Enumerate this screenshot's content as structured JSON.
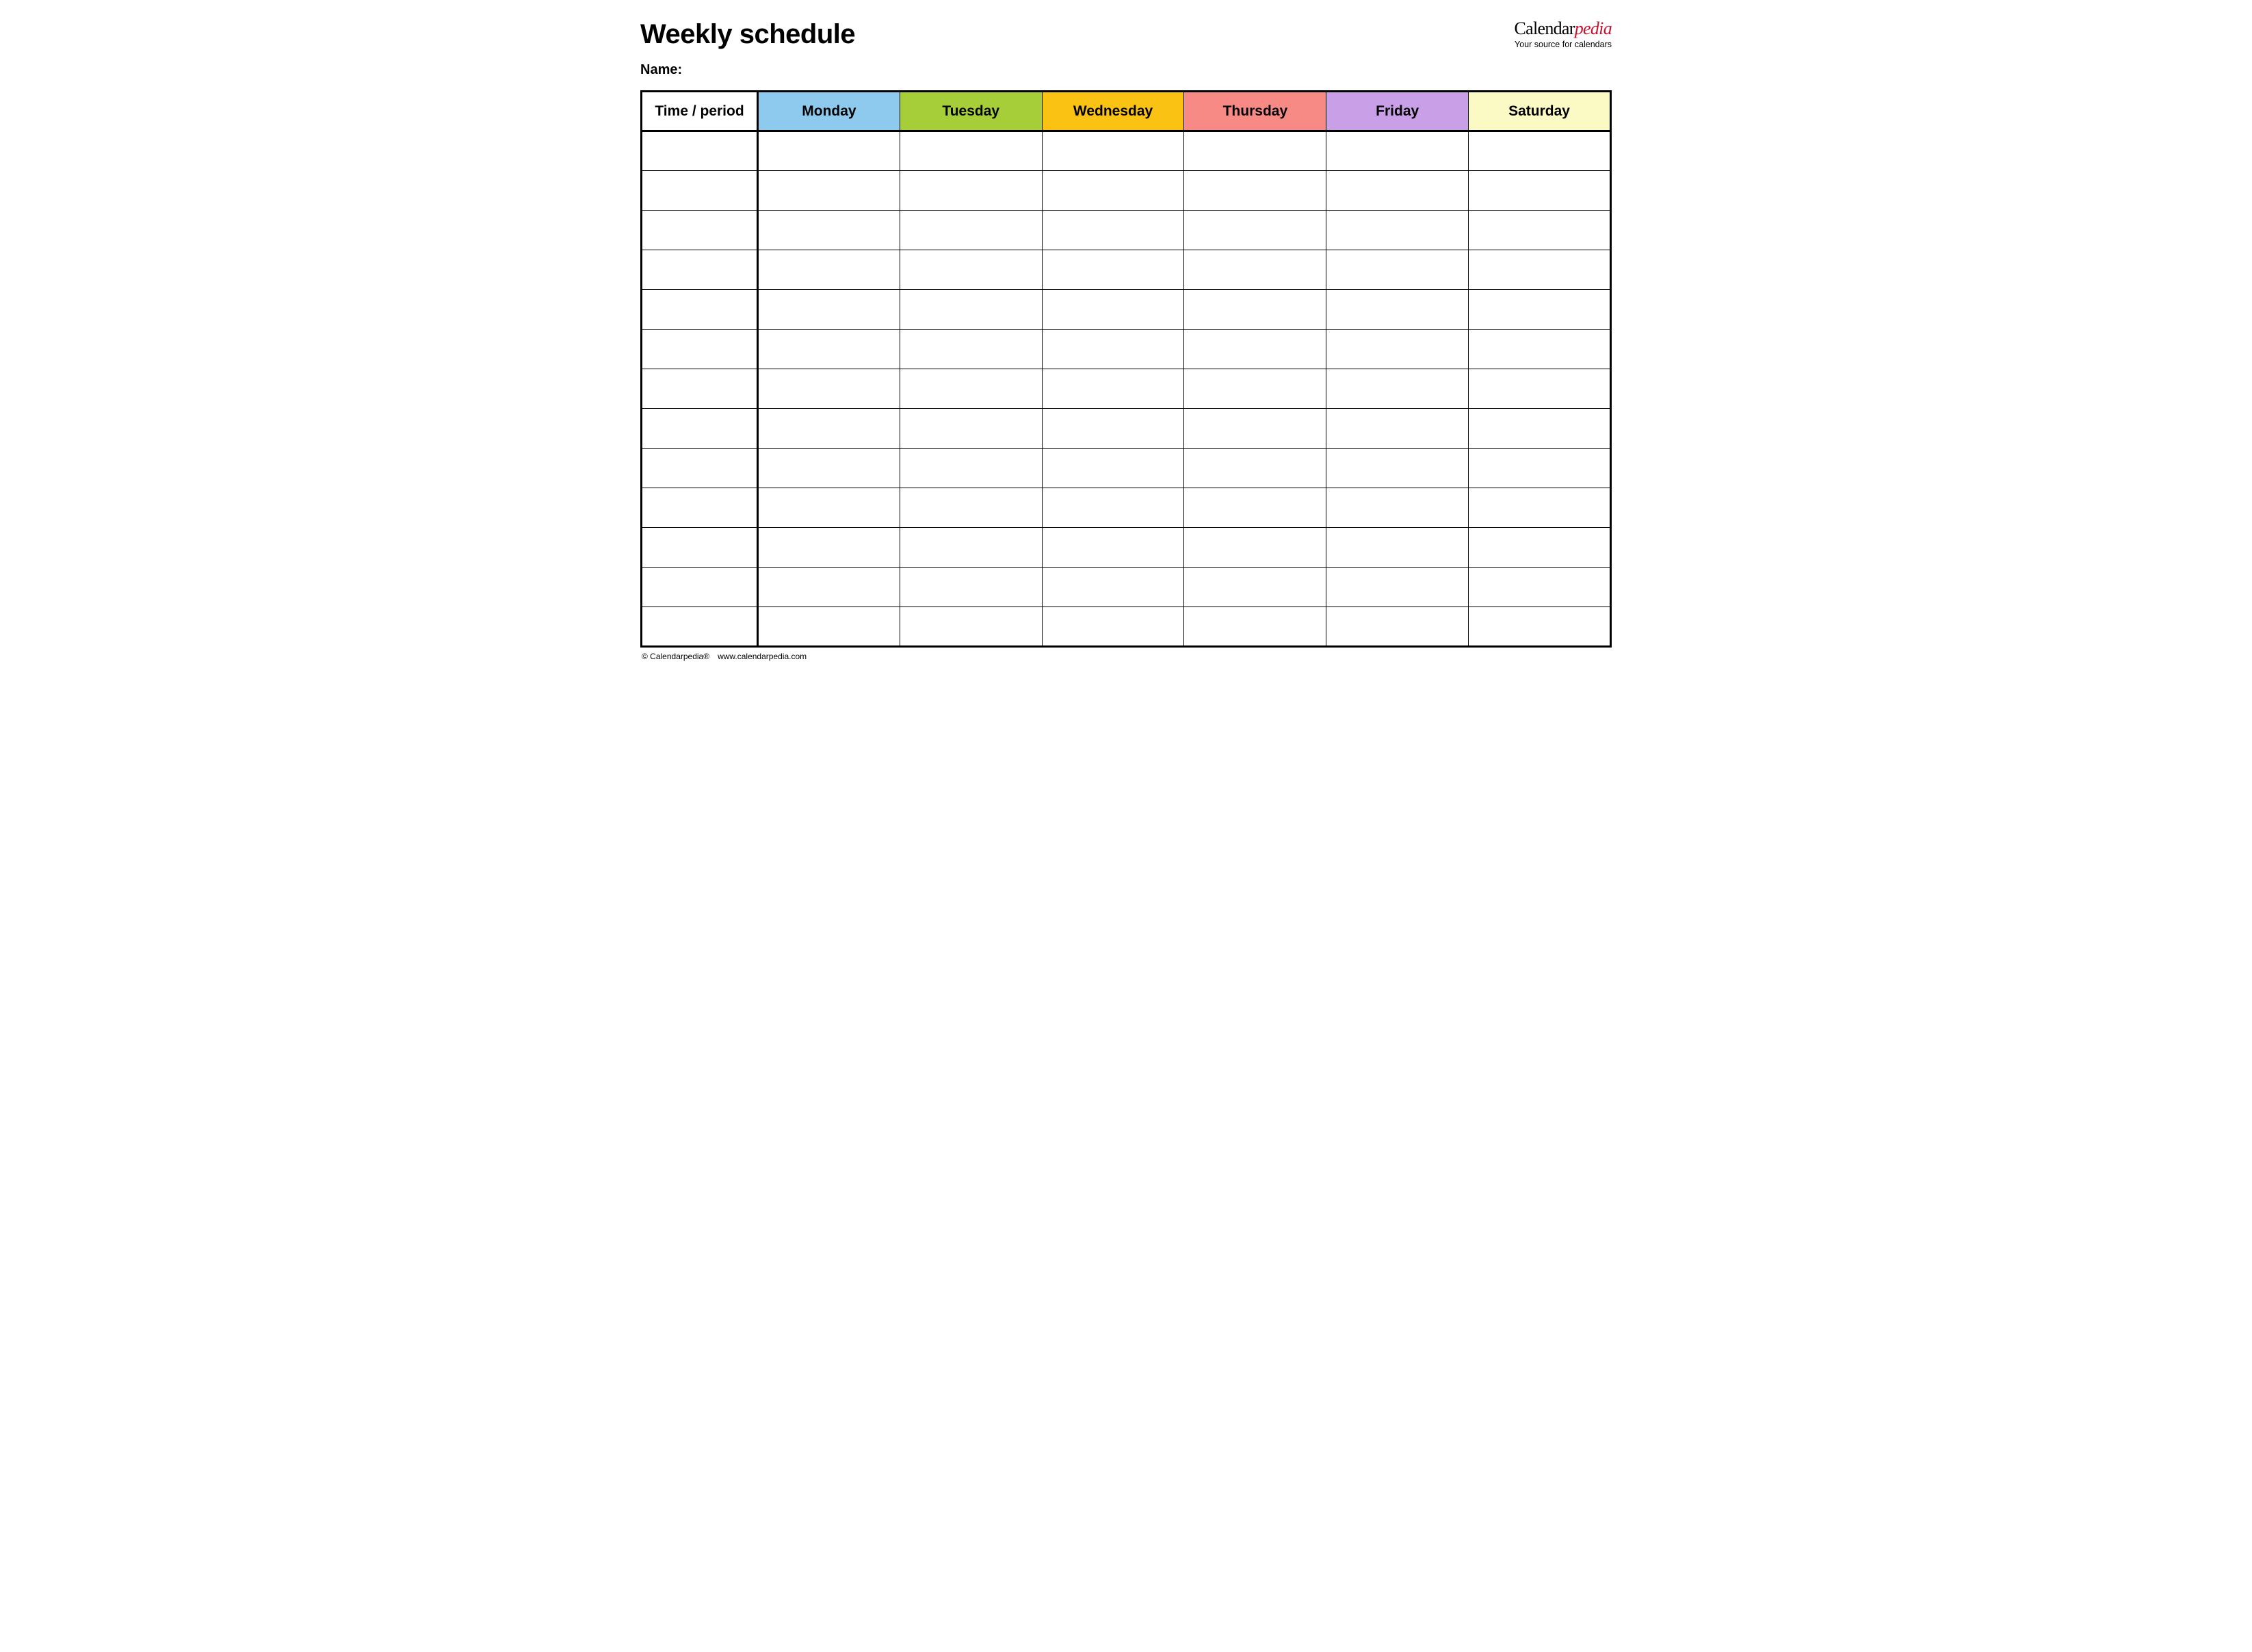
{
  "title": "Weekly schedule",
  "name_label": "Name:",
  "logo": {
    "part1": "Calendar",
    "part2": "pedia",
    "tagline": "Your source for calendars"
  },
  "columns": [
    {
      "label": "Time / period",
      "color": "#ffffff"
    },
    {
      "label": "Monday",
      "color": "#8ecaed"
    },
    {
      "label": "Tuesday",
      "color": "#a5ce39"
    },
    {
      "label": "Wednesday",
      "color": "#fac314"
    },
    {
      "label": "Thursday",
      "color": "#f78a85"
    },
    {
      "label": "Friday",
      "color": "#c9a0e8"
    },
    {
      "label": "Saturday",
      "color": "#fbf9c4"
    }
  ],
  "row_count": 13,
  "footer": {
    "copyright": "© Calendarpedia®",
    "url": "www.calendarpedia.com"
  }
}
